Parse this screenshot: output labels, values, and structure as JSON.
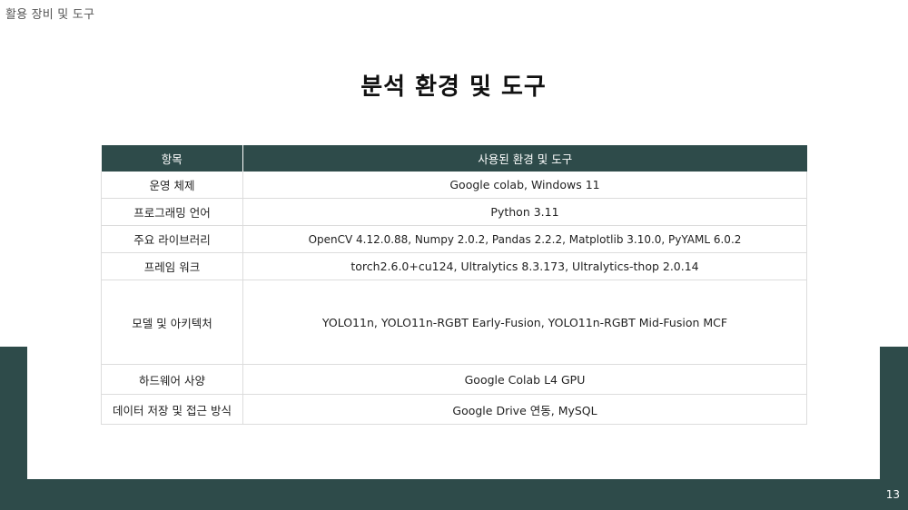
{
  "header": {
    "section_label": "활용 장비 및 도구"
  },
  "slide": {
    "title": "분석 환경 및 도구"
  },
  "table": {
    "headers": [
      "항목",
      "사용된 환경 및 도구"
    ],
    "rows": [
      {
        "item": "운영 체제",
        "value": "Google colab, Windows 11"
      },
      {
        "item": "프로그래밍 언어",
        "value": "Python 3.11"
      },
      {
        "item": "주요 라이브러리",
        "value": "OpenCV 4.12.0.88, Numpy 2.0.2, Pandas  2.2.2, Matplotlib 3.10.0, PyYAML 6.0.2"
      },
      {
        "item": "프레임 워크",
        "value": "torch2.6.0+cu124, Ultralytics 8.3.173, Ultralytics-thop 2.0.14"
      },
      {
        "item": "모델 및 아키텍처",
        "value": "YOLO11n, YOLO11n-RGBT Early-Fusion, YOLO11n-RGBT Mid-Fusion MCF"
      },
      {
        "item": "하드웨어 사양",
        "value": "Google Colab L4 GPU"
      },
      {
        "item": "데이터 저장 및 접근 방식",
        "value": "Google Drive 연동, MySQL"
      }
    ]
  },
  "footer": {
    "page_number": "13"
  },
  "colors": {
    "accent_dark_teal": "#2e4b4a",
    "background": "#ffffff",
    "grid_line": "#dcdcdc"
  }
}
